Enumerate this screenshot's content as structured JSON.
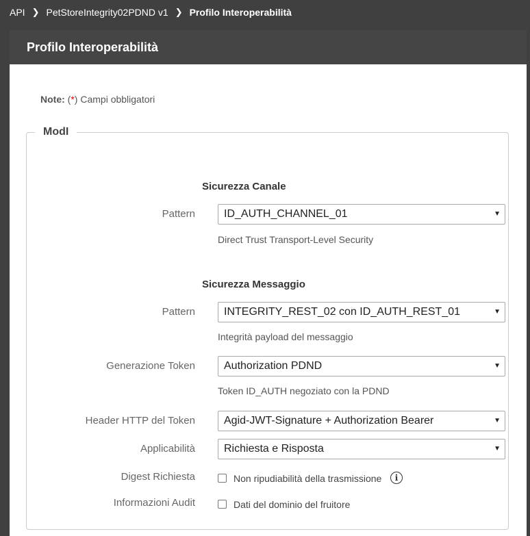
{
  "breadcrumb": {
    "items": [
      "API",
      "PetStoreIntegrity02PDND v1"
    ],
    "current": "Profilo Interoperabilità"
  },
  "header": {
    "title": "Profilo Interoperabilità"
  },
  "note": {
    "label": "Note:",
    "open": "(",
    "star": "*",
    "text": ") Campi obbligatori"
  },
  "fieldset": {
    "legend": "ModI"
  },
  "channel": {
    "title": "Sicurezza Canale",
    "pattern_label": "Pattern",
    "pattern_value": "ID_AUTH_CHANNEL_01",
    "pattern_hint": "Direct Trust Transport-Level Security"
  },
  "message": {
    "title": "Sicurezza Messaggio",
    "pattern_label": "Pattern",
    "pattern_value": "INTEGRITY_REST_02 con ID_AUTH_REST_01",
    "pattern_hint": "Integrità payload del messaggio",
    "token_label": "Generazione Token",
    "token_value": "Authorization PDND",
    "token_hint": "Token ID_AUTH negoziato con la PDND",
    "header_label": "Header HTTP del Token",
    "header_value": "Agid-JWT-Signature + Authorization Bearer",
    "applic_label": "Applicabilità",
    "applic_value": "Richiesta e Risposta",
    "digest_label": "Digest Richiesta",
    "digest_check": "Non ripudiabilità della trasmissione",
    "digest_checked": false,
    "audit_label": "Informazioni Audit",
    "audit_check": "Dati del dominio del fruitore",
    "audit_checked": false
  },
  "icons": {
    "separator": "chevron-right-icon",
    "dropdown": "chevron-down-icon",
    "info": "info-icon"
  }
}
